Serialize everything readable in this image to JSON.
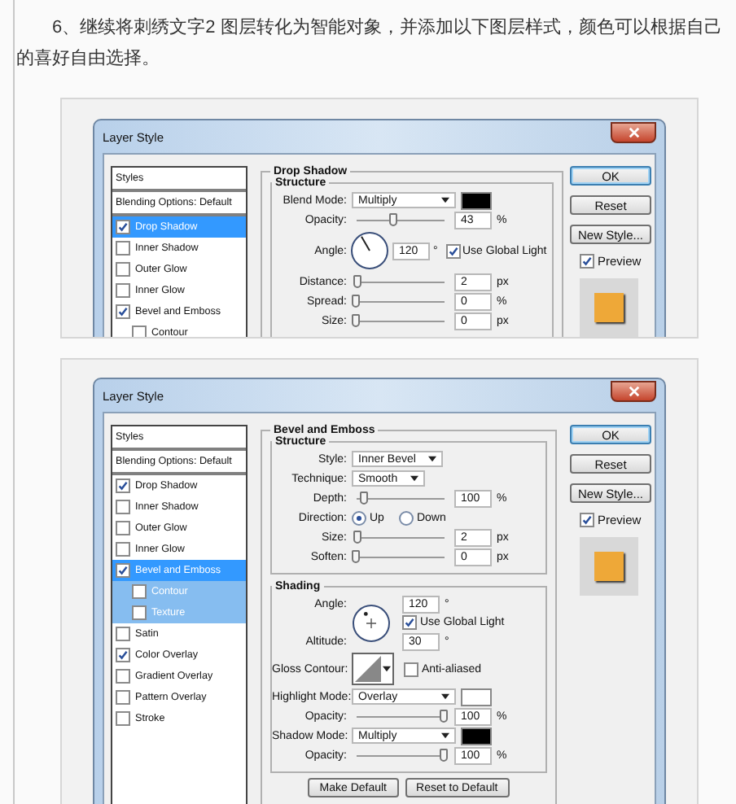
{
  "intro": "6、继续将刺绣文字2 图层转化为智能对象，并添加以下图层样式，颜色可以根据自己的喜好自由选择。",
  "dialogs": [
    {
      "title": "Layer Style",
      "styles": [
        {
          "label": "Styles",
          "kind": "header",
          "selected": false,
          "highlighted": false
        },
        {
          "label": "Blending Options: Default",
          "kind": "header",
          "selected": false,
          "highlighted": false
        },
        {
          "label": "Drop Shadow",
          "kind": "option",
          "checked": true,
          "selected": true,
          "highlighted": false
        },
        {
          "label": "Inner Shadow",
          "kind": "option",
          "checked": false,
          "selected": false,
          "highlighted": false
        },
        {
          "label": "Outer Glow",
          "kind": "option",
          "checked": false,
          "selected": false,
          "highlighted": false
        },
        {
          "label": "Inner Glow",
          "kind": "option",
          "checked": false,
          "selected": false,
          "highlighted": false
        },
        {
          "label": "Bevel and Emboss",
          "kind": "option",
          "checked": true,
          "selected": false,
          "highlighted": false
        },
        {
          "label": "Contour",
          "kind": "sub",
          "checked": false,
          "selected": false,
          "highlighted": false
        }
      ],
      "section": {
        "title": "Drop Shadow",
        "groups": [
          {
            "title": "Structure",
            "rows": [
              {
                "kind": "select",
                "label": "Blend Mode:",
                "value": "Multiply",
                "color": "#000000"
              },
              {
                "kind": "slider",
                "label": "Opacity:",
                "level": 0.43,
                "value": "43",
                "unit": "%"
              },
              {
                "kind": "angle",
                "label": "Angle:",
                "value": "120",
                "unit": "°",
                "checkbox": {
                  "label": "Use Global Light",
                  "checked": true
                }
              },
              {
                "kind": "slider",
                "label": "Distance:",
                "level": 0.02,
                "value": "2",
                "unit": "px"
              },
              {
                "kind": "slider",
                "label": "Spread:",
                "level": 0,
                "value": "0",
                "unit": "%"
              },
              {
                "kind": "slider",
                "label": "Size:",
                "level": 0,
                "value": "0",
                "unit": "px"
              }
            ]
          }
        ]
      },
      "buttons": [
        {
          "label": "OK",
          "default": true
        },
        {
          "label": "Reset",
          "default": false
        },
        {
          "label": "New Style...",
          "default": false
        }
      ],
      "preview": {
        "label": "Preview",
        "checked": true,
        "color": "#eea838"
      }
    },
    {
      "title": "Layer Style",
      "styles": [
        {
          "label": "Styles",
          "kind": "header",
          "selected": false,
          "highlighted": false
        },
        {
          "label": "Blending Options: Default",
          "kind": "header",
          "selected": false,
          "highlighted": false
        },
        {
          "label": "Drop Shadow",
          "kind": "option",
          "checked": true,
          "selected": false,
          "highlighted": false
        },
        {
          "label": "Inner Shadow",
          "kind": "option",
          "checked": false,
          "selected": false,
          "highlighted": false
        },
        {
          "label": "Outer Glow",
          "kind": "option",
          "checked": false,
          "selected": false,
          "highlighted": false
        },
        {
          "label": "Inner Glow",
          "kind": "option",
          "checked": false,
          "selected": false,
          "highlighted": false
        },
        {
          "label": "Bevel and Emboss",
          "kind": "option",
          "checked": true,
          "selected": true,
          "highlighted": false
        },
        {
          "label": "Contour",
          "kind": "sub",
          "checked": false,
          "selected": false,
          "highlighted": true
        },
        {
          "label": "Texture",
          "kind": "sub",
          "checked": false,
          "selected": false,
          "highlighted": true
        },
        {
          "label": "Satin",
          "kind": "option",
          "checked": false,
          "selected": false,
          "highlighted": false
        },
        {
          "label": "Color Overlay",
          "kind": "option",
          "checked": true,
          "selected": false,
          "highlighted": false
        },
        {
          "label": "Gradient Overlay",
          "kind": "option",
          "checked": false,
          "selected": false,
          "highlighted": false
        },
        {
          "label": "Pattern Overlay",
          "kind": "option",
          "checked": false,
          "selected": false,
          "highlighted": false
        },
        {
          "label": "Stroke",
          "kind": "option",
          "checked": false,
          "selected": false,
          "highlighted": false
        }
      ],
      "section": {
        "title": "Bevel and Emboss",
        "groups": [
          {
            "title": "Structure",
            "rows": [
              {
                "kind": "select",
                "label": "Style:",
                "value": "Inner Bevel"
              },
              {
                "kind": "select",
                "label": "Technique:",
                "value": "Smooth"
              },
              {
                "kind": "slider",
                "label": "Depth:",
                "level": 0.1,
                "value": "100",
                "unit": "%"
              },
              {
                "kind": "radio",
                "label": "Direction:",
                "options": [
                  {
                    "label": "Up",
                    "selected": true
                  },
                  {
                    "label": "Down",
                    "selected": false
                  }
                ]
              },
              {
                "kind": "slider",
                "label": "Size:",
                "level": 0.02,
                "value": "2",
                "unit": "px"
              },
              {
                "kind": "slider",
                "label": "Soften:",
                "level": 0,
                "value": "0",
                "unit": "px"
              }
            ]
          },
          {
            "title": "Shading",
            "rows": [
              {
                "kind": "shading_angle",
                "label": "Angle:",
                "value": "120",
                "unit": "°",
                "checkbox": {
                  "label": "Use Global Light",
                  "checked": true
                },
                "altitude_label": "Altitude:",
                "altitude_value": "30",
                "altitude_unit": "°"
              },
              {
                "kind": "gloss",
                "label": "Gloss Contour:",
                "checkbox": {
                  "label": "Anti-aliased",
                  "checked": false
                }
              },
              {
                "kind": "select",
                "label": "Highlight Mode:",
                "value": "Overlay",
                "color": "#ffffff"
              },
              {
                "kind": "slider",
                "label": "Opacity:",
                "level": 1,
                "value": "100",
                "unit": "%"
              },
              {
                "kind": "select",
                "label": "Shadow Mode:",
                "value": "Multiply",
                "color": "#000000"
              },
              {
                "kind": "slider",
                "label": "Opacity:",
                "level": 1,
                "value": "100",
                "unit": "%"
              }
            ]
          }
        ],
        "footer_buttons": [
          "Make Default",
          "Reset to Default"
        ]
      },
      "buttons": [
        {
          "label": "OK",
          "default": true
        },
        {
          "label": "Reset",
          "default": false
        },
        {
          "label": "New Style...",
          "default": false
        }
      ],
      "preview": {
        "label": "Preview",
        "checked": true,
        "color": "#eea838"
      }
    }
  ]
}
